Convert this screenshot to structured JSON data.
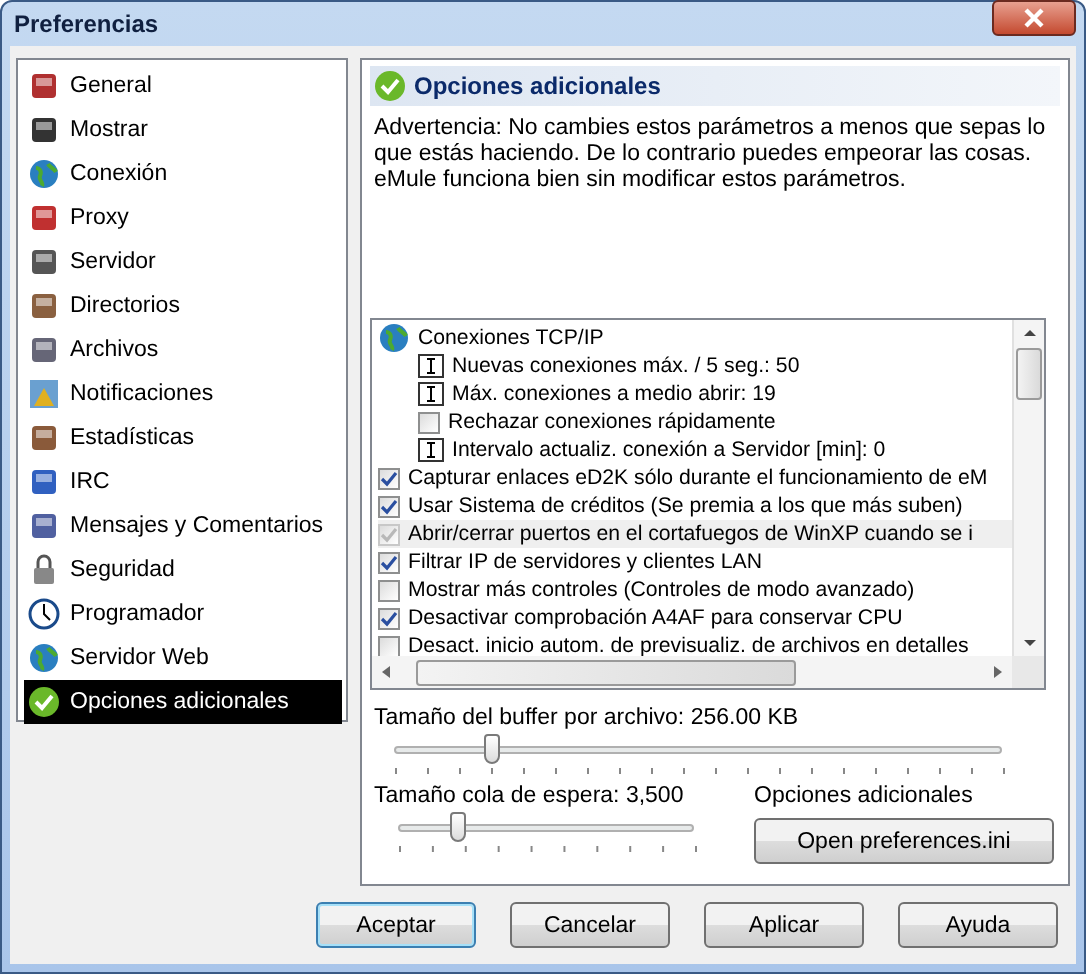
{
  "window": {
    "title": "Preferencias"
  },
  "sidebar": {
    "items": [
      {
        "label": "General",
        "selected": false
      },
      {
        "label": "Mostrar",
        "selected": false
      },
      {
        "label": "Conexión",
        "selected": false
      },
      {
        "label": "Proxy",
        "selected": false
      },
      {
        "label": "Servidor",
        "selected": false
      },
      {
        "label": "Directorios",
        "selected": false
      },
      {
        "label": "Archivos",
        "selected": false
      },
      {
        "label": "Notificaciones",
        "selected": false
      },
      {
        "label": "Estadísticas",
        "selected": false
      },
      {
        "label": "IRC",
        "selected": false
      },
      {
        "label": "Mensajes y Comentarios",
        "selected": false
      },
      {
        "label": "Seguridad",
        "selected": false
      },
      {
        "label": "Programador",
        "selected": false
      },
      {
        "label": "Servidor Web",
        "selected": false
      },
      {
        "label": "Opciones adicionales",
        "selected": true
      }
    ]
  },
  "panel": {
    "title": "Opciones adicionales",
    "warning": "Advertencia: No cambies estos parámetros a menos que sepas lo que estás haciendo. De lo contrario puedes empeorar las cosas. eMule funciona bien sin modificar estos parámetros.",
    "options": [
      {
        "kind": "group",
        "label": "Conexiones TCP/IP",
        "children": [
          {
            "kind": "edit",
            "label": "Nuevas conexiones máx. / 5 seg.: 50"
          },
          {
            "kind": "edit",
            "label": "Máx. conexiones a medio abrir: 19"
          },
          {
            "kind": "checkbox",
            "label": "Rechazar conexiones rápidamente",
            "checked": false,
            "disabled": false
          },
          {
            "kind": "edit",
            "label": "Intervalo actualiz. conexión a Servidor [min]: 0"
          }
        ]
      },
      {
        "kind": "checkbox",
        "label": "Capturar enlaces eD2K sólo durante el funcionamiento de eM",
        "checked": true,
        "disabled": false
      },
      {
        "kind": "checkbox",
        "label": "Usar Sistema de créditos (Se premia a los que más suben)",
        "checked": true,
        "disabled": false
      },
      {
        "kind": "checkbox",
        "label": "Abrir/cerrar puertos en el cortafuegos de WinXP cuando se i",
        "checked": true,
        "disabled": true
      },
      {
        "kind": "checkbox",
        "label": "Filtrar IP de servidores y clientes LAN",
        "checked": true,
        "disabled": false
      },
      {
        "kind": "checkbox",
        "label": "Mostrar más controles (Controles de modo avanzado)",
        "checked": false,
        "disabled": false
      },
      {
        "kind": "checkbox",
        "label": "Desactivar comprobación A4AF para conservar CPU",
        "checked": true,
        "disabled": false
      },
      {
        "kind": "checkbox",
        "label": "Desact. inicio autom. de previsualiz. de archivos en detalles",
        "checked": false,
        "disabled": false
      }
    ],
    "buffer": {
      "label": "Tamaño del buffer por archivo: 256.00 KB",
      "level": 0.16
    },
    "queue": {
      "label": "Tamaño cola de espera: 3,500",
      "level": 0.2
    },
    "extra_label": "Opciones adicionales",
    "ini_button": "Open preferences.ini"
  },
  "buttons": [
    {
      "label": "Aceptar",
      "default": true
    },
    {
      "label": "Cancelar",
      "default": false
    },
    {
      "label": "Aplicar",
      "default": false
    },
    {
      "label": "Ayuda",
      "default": false
    }
  ]
}
